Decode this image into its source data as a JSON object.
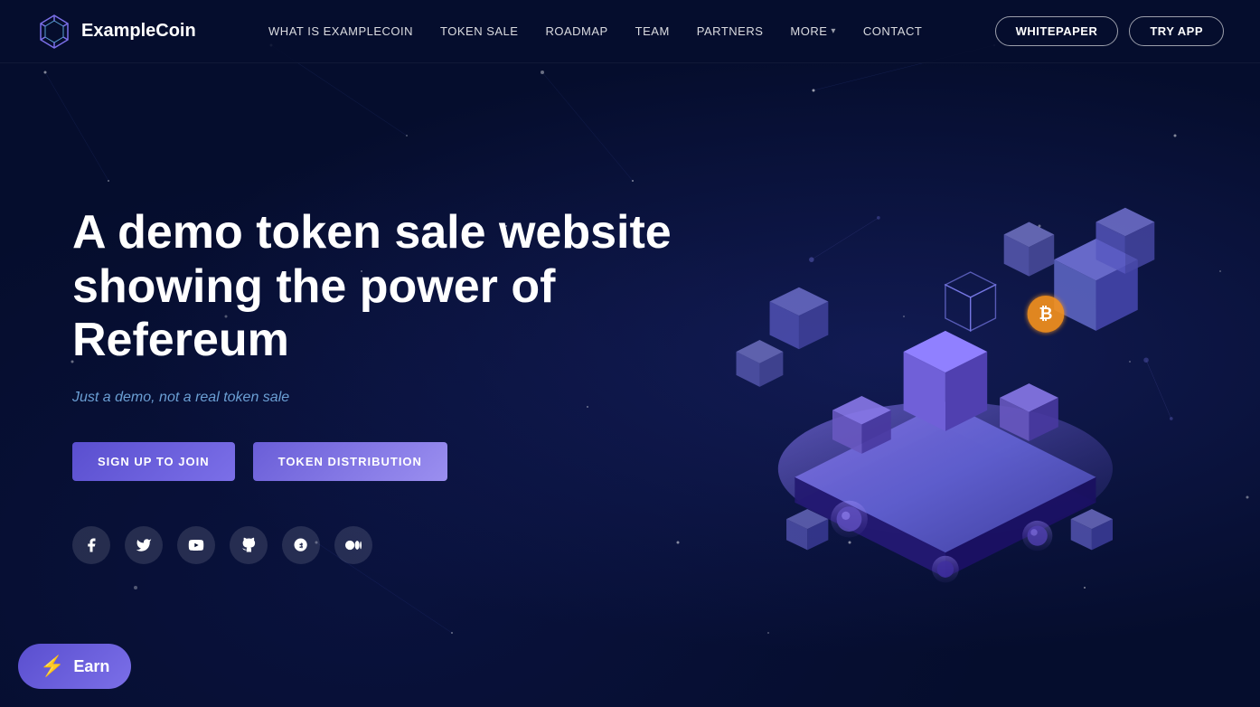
{
  "brand": {
    "name": "ExampleCoin",
    "logo_alt": "ExampleCoin Logo"
  },
  "nav": {
    "links": [
      {
        "label": "WHAT IS EXAMPLECOIN",
        "id": "what-is"
      },
      {
        "label": "TOKEN SALE",
        "id": "token-sale"
      },
      {
        "label": "ROADMAP",
        "id": "roadmap"
      },
      {
        "label": "TEAM",
        "id": "team"
      },
      {
        "label": "PARTNERS",
        "id": "partners"
      },
      {
        "label": "MORE",
        "id": "more",
        "has_dropdown": true
      },
      {
        "label": "CONTACT",
        "id": "contact"
      }
    ],
    "whitepaper_label": "WHITEPAPER",
    "try_app_label": "TRY APP"
  },
  "hero": {
    "title": "A demo token sale website showing the power of Refereum",
    "subtitle": "Just a demo, not a real token sale",
    "cta_primary": "SIGN UP TO JOIN",
    "cta_secondary": "TOKEN DISTRIBUTION"
  },
  "social": {
    "facebook_label": "Facebook",
    "twitter_label": "Twitter",
    "youtube_label": "YouTube",
    "github_label": "GitHub",
    "bitcoin_label": "Bitcoin",
    "medium_label": "Medium"
  },
  "earn_widget": {
    "label": "Earn",
    "icon": "⚡"
  },
  "colors": {
    "bg_dark": "#050d2d",
    "accent_purple": "#6a5ed8",
    "accent_blue": "#6b9fd4",
    "nav_bg": "rgba(5,13,45,0.9)"
  }
}
